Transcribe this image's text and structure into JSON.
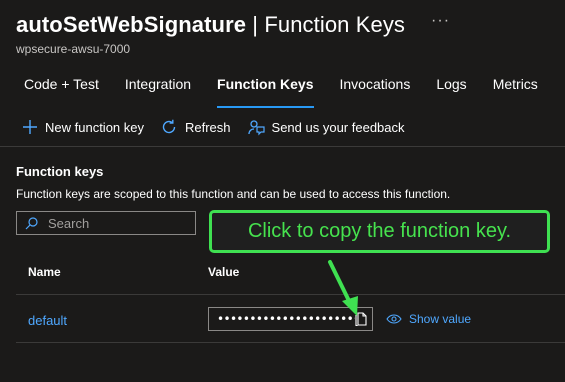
{
  "header": {
    "function_name": "autoSetWebSignature",
    "separator": " | ",
    "page_name": "Function Keys",
    "more_label": "···",
    "subtitle": "wpsecure-awsu-7000"
  },
  "tabs": [
    {
      "label": "Code + Test",
      "active": false
    },
    {
      "label": "Integration",
      "active": false
    },
    {
      "label": "Function Keys",
      "active": true
    },
    {
      "label": "Invocations",
      "active": false
    },
    {
      "label": "Logs",
      "active": false
    },
    {
      "label": "Metrics",
      "active": false
    }
  ],
  "toolbar": {
    "new_key": "New function key",
    "refresh": "Refresh",
    "feedback": "Send us your feedback"
  },
  "section": {
    "title": "Function keys",
    "description": "Function keys are scoped to this function and can be used to access this function."
  },
  "search": {
    "placeholder": "Search"
  },
  "callout": {
    "text": "Click to copy the function key."
  },
  "table": {
    "columns": [
      "Name",
      "Value"
    ],
    "rows": [
      {
        "name": "default",
        "value_masked": "••••••••••••••••••••••••••...",
        "show_label": "Show value"
      }
    ]
  },
  "colors": {
    "accent": "#2899f5",
    "link": "#4fa8ff",
    "callout_green": "#3fe051",
    "background": "#1b1a19"
  },
  "icons": [
    "plus-icon",
    "refresh-icon",
    "feedback-icon",
    "search-icon",
    "copy-icon",
    "eye-icon",
    "more-icon"
  ]
}
